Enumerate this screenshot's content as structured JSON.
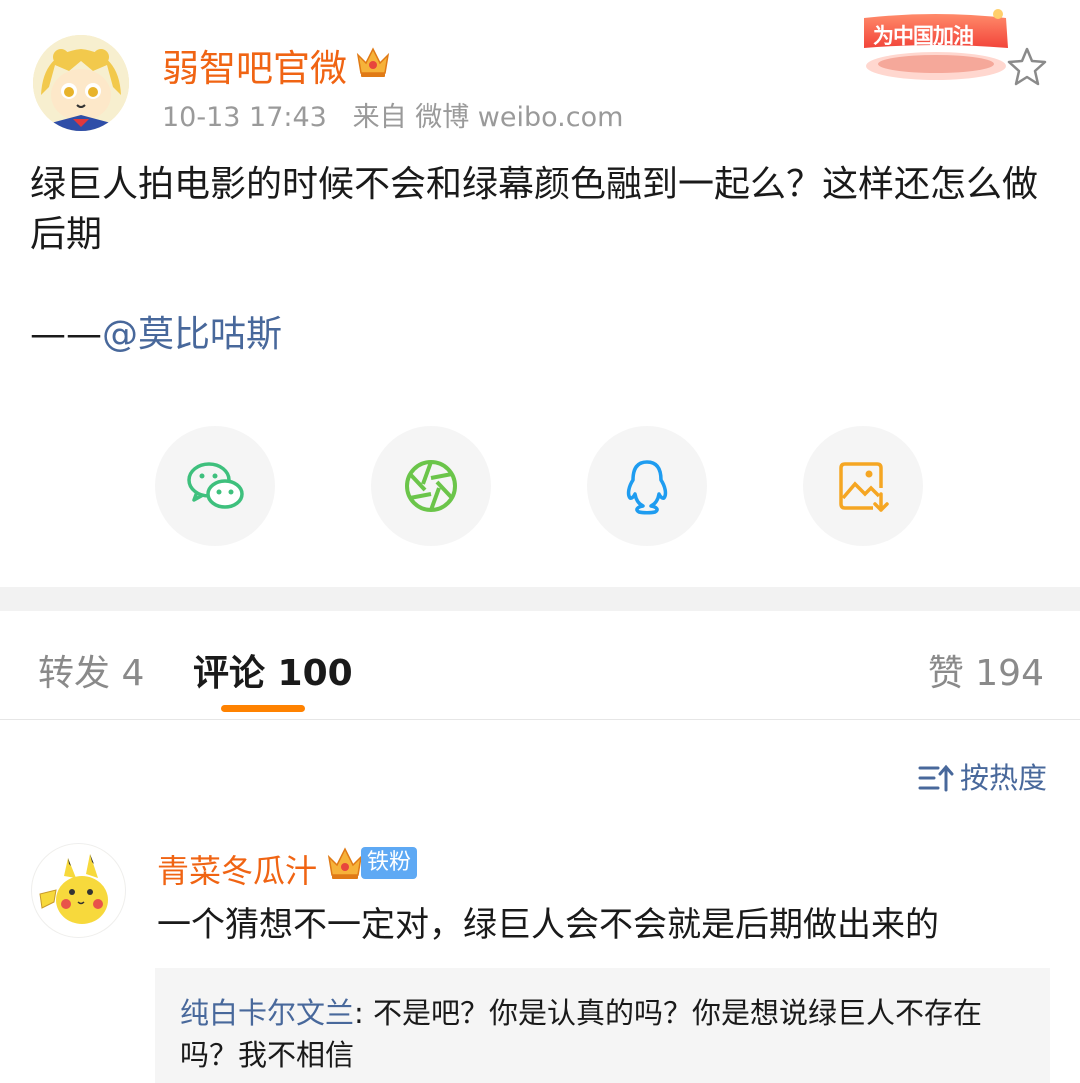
{
  "post": {
    "author": "弱智吧官微",
    "author_badge_icon": "crown-icon",
    "timestamp": "10-13 17:43",
    "source_label": "来自",
    "source": "微博 weibo.com",
    "event_badge": "为中国加油",
    "text": "绿巨人拍电影的时候不会和绿幕颜色融到一起么？这样还怎么做后期",
    "attribution_dash": "——",
    "attribution_mention": "@莫比咕斯"
  },
  "share": [
    {
      "name": "wechat-icon",
      "color": "#3ec07d"
    },
    {
      "name": "moments-icon",
      "color": "#6bc54a"
    },
    {
      "name": "qq-icon",
      "color": "#1e9cf0"
    },
    {
      "name": "save-image-icon",
      "color": "#f5a623"
    }
  ],
  "tabs": {
    "repost": "转发 4",
    "comment": "评论 100",
    "like": "赞 194"
  },
  "sort": {
    "label": "按热度"
  },
  "comments": [
    {
      "user": "青菜冬瓜汁",
      "fan_badge": "铁粉",
      "text": "一个猜想不一定对，绿巨人会不会就是后期做出来的",
      "reply": {
        "user": "纯白卡尔文兰",
        "separator": ": ",
        "text": "不是吧？你是认真的吗？你是想说绿巨人不存在吗？我不相信"
      }
    }
  ],
  "colors": {
    "accent": "#ff8200",
    "username": "#f06413",
    "link": "#48689b"
  }
}
